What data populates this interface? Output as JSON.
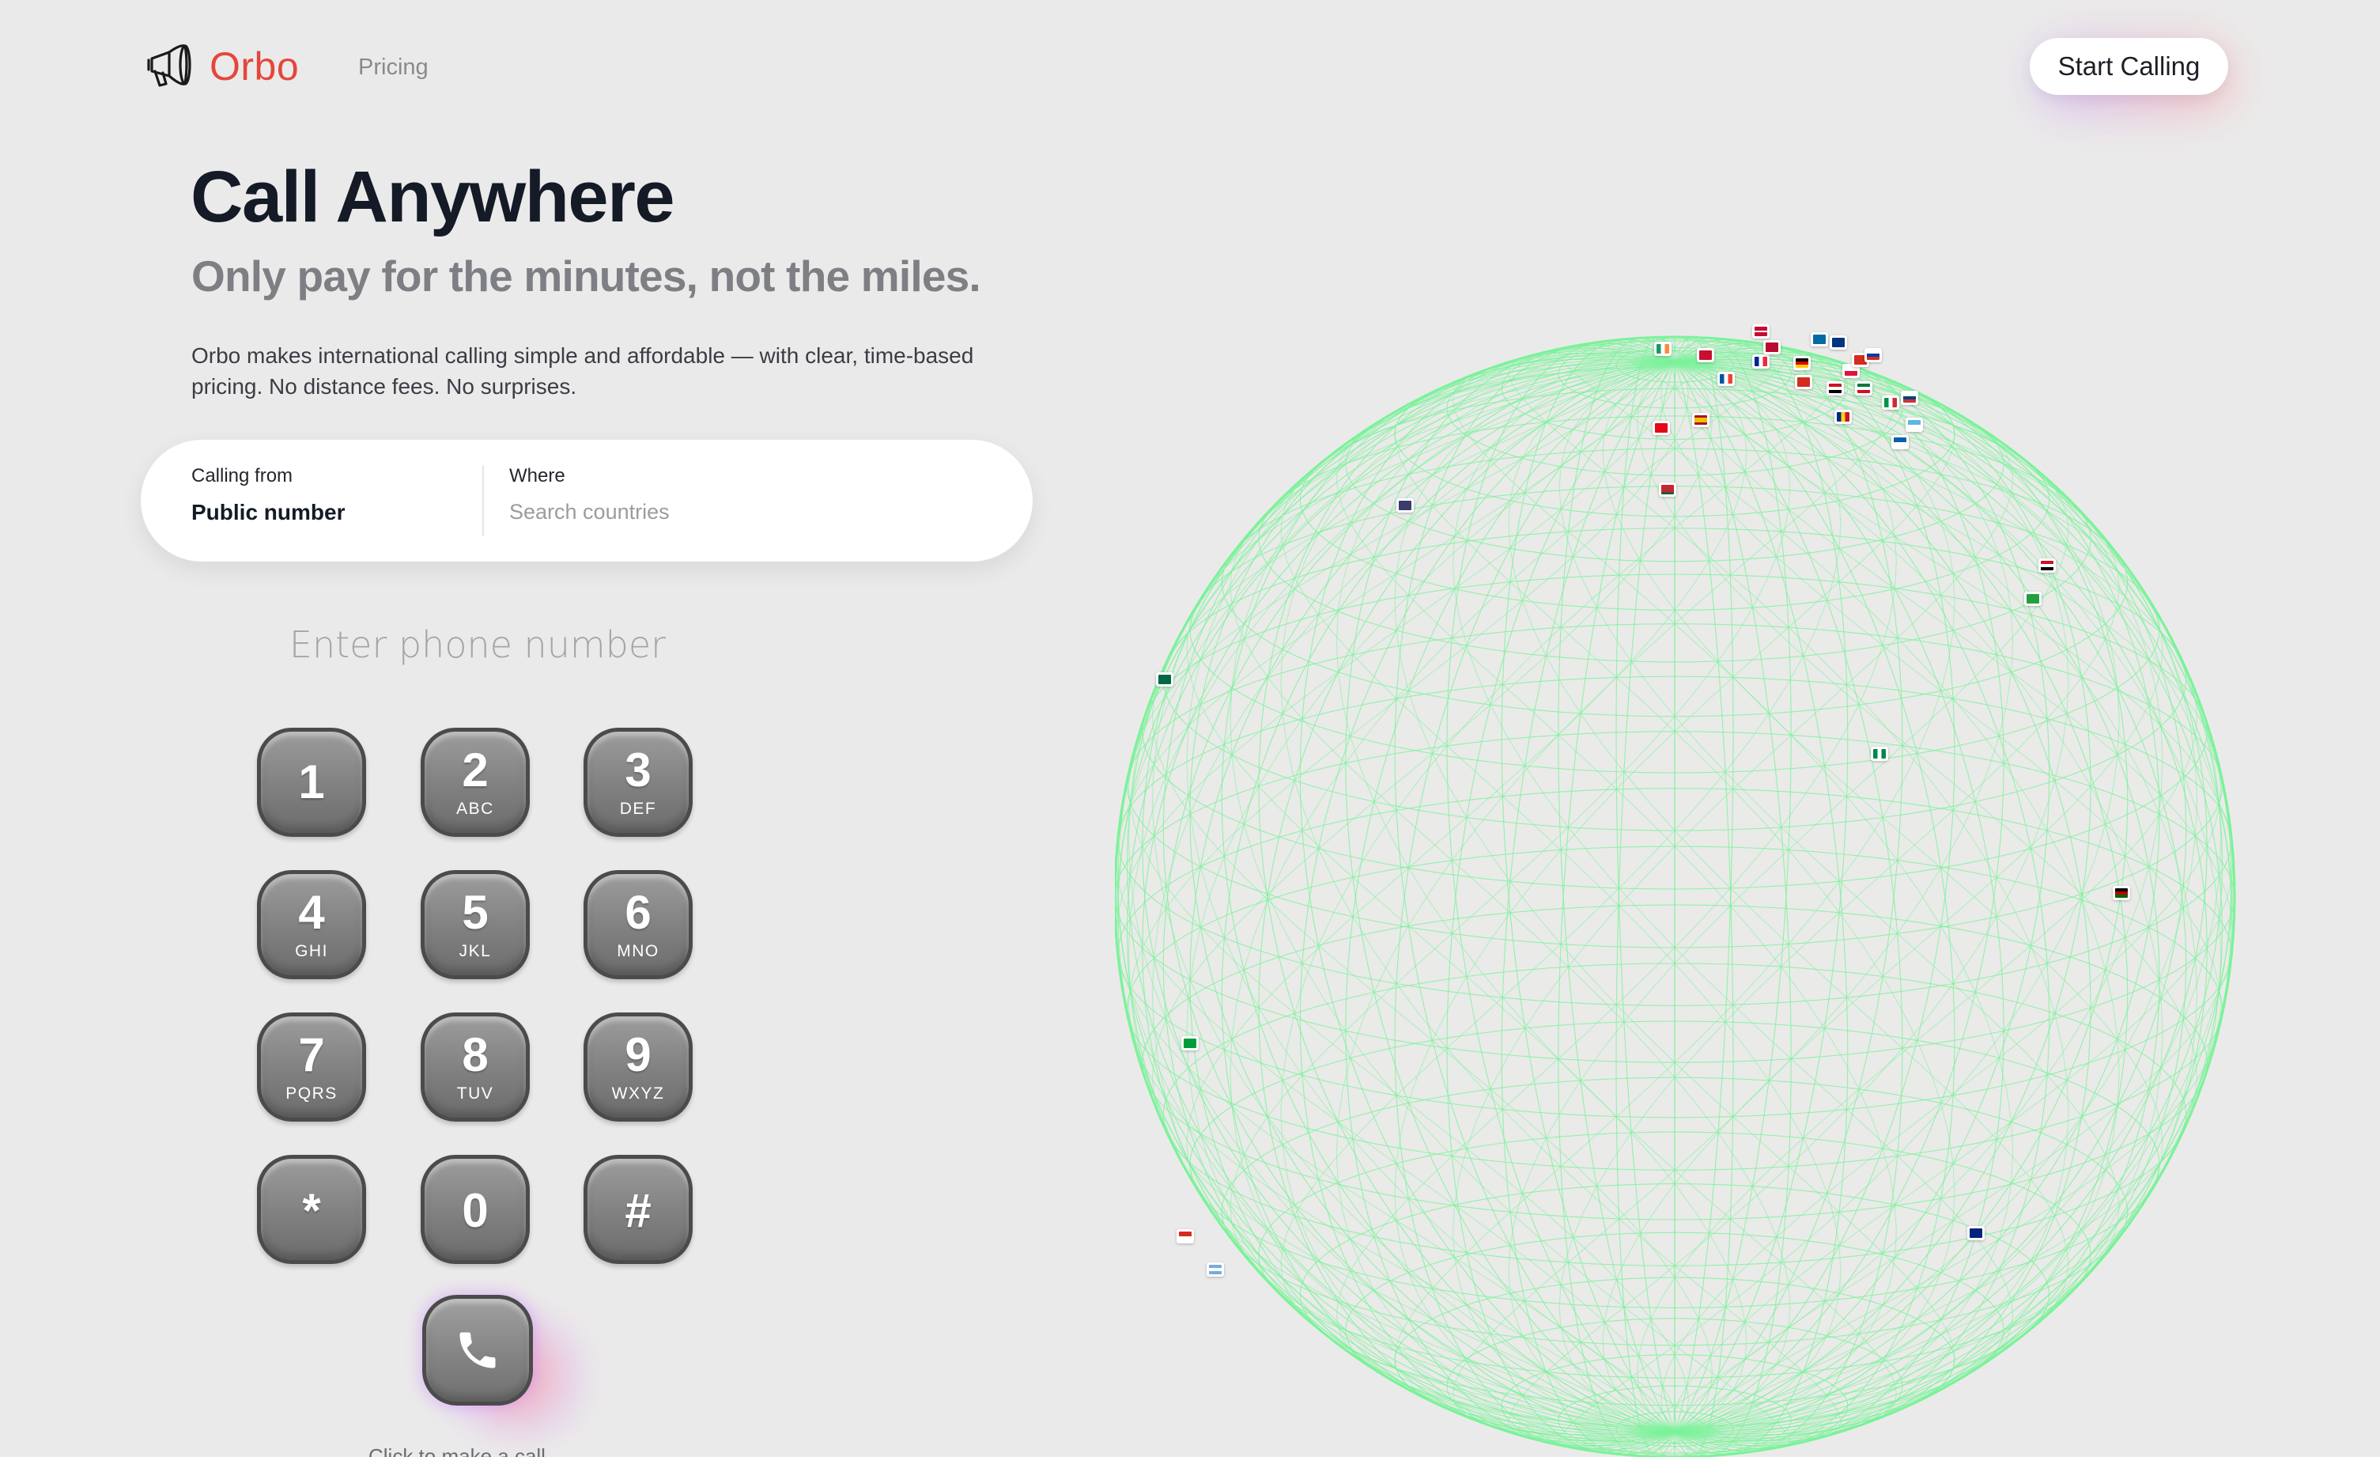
{
  "header": {
    "brand": "Orbo",
    "logo_icon": "megaphone-icon",
    "nav": {
      "pricing": "Pricing"
    },
    "cta": "Start Calling"
  },
  "hero": {
    "title": "Call Anywhere",
    "subtitle": "Only pay for the minutes, not the miles.",
    "description": "Orbo makes international calling simple and affordable — with clear, time-based pricing. No distance fees. No surprises."
  },
  "search": {
    "calling_from_label": "Calling from",
    "calling_from_value": "Public number",
    "where_label": "Where",
    "where_placeholder": "Search countries"
  },
  "dialer": {
    "phone_placeholder": "Enter phone number",
    "keys": [
      {
        "digit": "1",
        "letters": ""
      },
      {
        "digit": "2",
        "letters": "ABC"
      },
      {
        "digit": "3",
        "letters": "DEF"
      },
      {
        "digit": "4",
        "letters": "GHI"
      },
      {
        "digit": "5",
        "letters": "JKL"
      },
      {
        "digit": "6",
        "letters": "MNO"
      },
      {
        "digit": "7",
        "letters": "PQRS"
      },
      {
        "digit": "8",
        "letters": "TUV"
      },
      {
        "digit": "9",
        "letters": "WXYZ"
      },
      {
        "digit": "*",
        "letters": ""
      },
      {
        "digit": "0",
        "letters": ""
      },
      {
        "digit": "#",
        "letters": ""
      }
    ],
    "call_icon": "phone-icon",
    "below_call_text": "Click to make a call"
  },
  "globe": {
    "wire_color": "#7cf29a",
    "marker_icon": "country-flag-marker-icon"
  },
  "colors": {
    "brand": "#e5463b",
    "background": "#ebeaea",
    "title": "#141a26",
    "subtitle": "#7d7f84"
  }
}
